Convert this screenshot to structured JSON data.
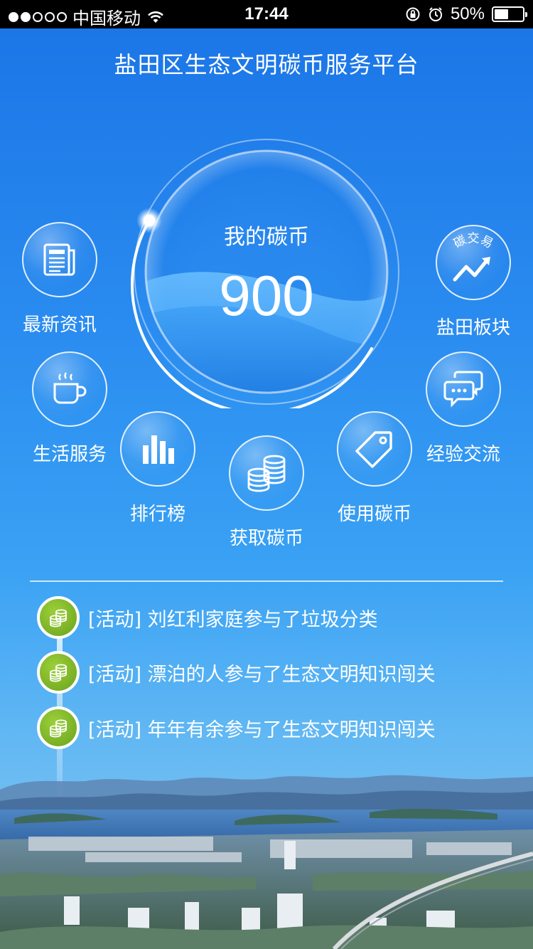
{
  "status_bar": {
    "carrier": "中国移动",
    "time": "17:44",
    "battery": "50%",
    "battery_level": 0.5
  },
  "header": {
    "title": "盐田区生态文明碳币服务平台"
  },
  "coin": {
    "label": "我的碳币",
    "value": "900"
  },
  "features": {
    "news": "最新资讯",
    "yantian": "盐田板块",
    "trade_badge": "碳交易",
    "life": "生活服务",
    "exchange": "经验交流",
    "ranking": "排行榜",
    "use_coin": "使用碳币",
    "get_coin": "获取碳币"
  },
  "activities": [
    {
      "text": "[活动] 刘红利家庭参与了垃圾分类"
    },
    {
      "text": "[活动] 漂泊的人参与了生态文明知识闯关"
    },
    {
      "text": "[活动] 年年有余参与了生态文明知识闯关"
    }
  ],
  "colors": {
    "background_top": "#1a74e6",
    "background_bottom": "#8fcaf0",
    "activity_green": "#7cb32a"
  }
}
